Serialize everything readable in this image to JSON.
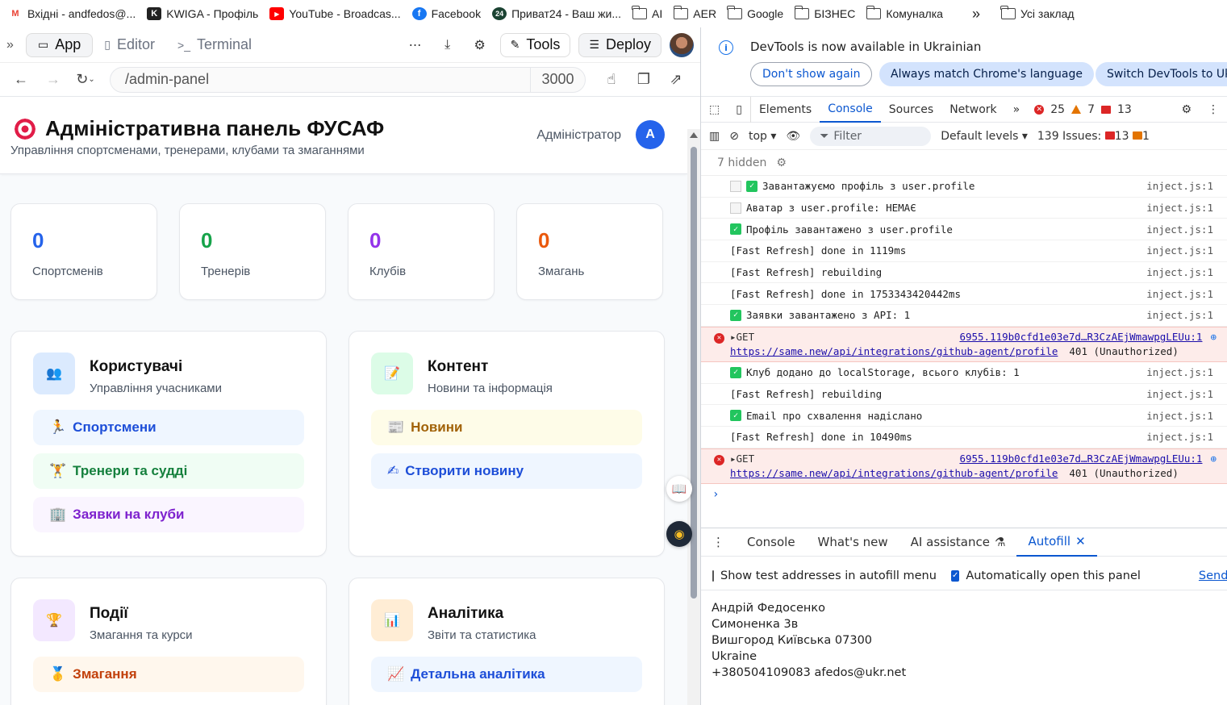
{
  "bookmarks": [
    {
      "label": "Вхідні - andfedos@...",
      "icon": "gmail-icon"
    },
    {
      "label": "KWIGA - Профіль",
      "icon": "kwiga-icon"
    },
    {
      "label": "YouTube - Broadcas...",
      "icon": "youtube-icon"
    },
    {
      "label": "Facebook",
      "icon": "facebook-icon"
    },
    {
      "label": "Приват24 - Ваш жи...",
      "icon": "privat24-icon"
    },
    {
      "label": "AI",
      "icon": "folder-icon"
    },
    {
      "label": "AER",
      "icon": "folder-icon"
    },
    {
      "label": "Google",
      "icon": "folder-icon"
    },
    {
      "label": "БІЗНЕС",
      "icon": "folder-icon"
    },
    {
      "label": "Комуналка",
      "icon": "folder-icon"
    },
    {
      "label": "Усі заклад",
      "icon": "folder-icon"
    }
  ],
  "topbar": {
    "tabs": [
      {
        "label": "App",
        "icon": "browser-icon"
      },
      {
        "label": "Editor",
        "icon": "file-icon"
      },
      {
        "label": "Terminal",
        "icon": "terminal-icon"
      }
    ],
    "tools_label": "Tools",
    "deploy_label": "Deploy"
  },
  "addressbar": {
    "url": "/admin-panel",
    "port": "3000"
  },
  "header": {
    "title": "Адміністративна панель ФУСАФ",
    "subtitle": "Управління спортсменами, тренерами, клубами та змаганнями",
    "role": "Адміністратор",
    "avatar_letter": "A"
  },
  "stats": [
    {
      "value": "0",
      "label": "Спортсменів",
      "color": "#2563eb"
    },
    {
      "value": "0",
      "label": "Тренерів",
      "color": "#16a34a"
    },
    {
      "value": "0",
      "label": "Клубів",
      "color": "#9333ea"
    },
    {
      "value": "0",
      "label": "Змагань",
      "color": "#ea580c"
    }
  ],
  "cards": {
    "users": {
      "title": "Користувачі",
      "subtitle": "Управління учасниками",
      "links": [
        "Спортсмени",
        "Тренери та судді",
        "Заявки на клуби"
      ]
    },
    "content": {
      "title": "Контент",
      "subtitle": "Новини та інформація",
      "links": [
        "Новини",
        "Створити новину"
      ]
    },
    "events": {
      "title": "Події",
      "subtitle": "Змагання та курси",
      "links": [
        "Змагання"
      ]
    },
    "analytics": {
      "title": "Аналітика",
      "subtitle": "Звіти та статистика",
      "links": [
        "Детальна аналітика"
      ]
    }
  },
  "devtools": {
    "info": "DevTools is now available in Ukrainian",
    "btn_dont_show": "Don't show again",
    "btn_match": "Always match Chrome's language",
    "btn_switch": "Switch DevTools to Uk",
    "tabs": [
      "Elements",
      "Console",
      "Sources",
      "Network"
    ],
    "errors": "25",
    "warnings": "7",
    "issues_count": "13",
    "context": "top",
    "filter": "Filter",
    "levels": "Default levels",
    "issues_label": "139 Issues:",
    "issues_red": "13",
    "issues_orange": "1",
    "hidden": "7 hidden",
    "logs": [
      {
        "text": "Завантажуємо профіль з user.profile",
        "src": "inject.js:1",
        "icons": "memo-check"
      },
      {
        "text": "Аватар з user.profile: НЕМАЄ",
        "src": "inject.js:1",
        "icons": "memo"
      },
      {
        "text": "Профіль завантажено з user.profile",
        "src": "inject.js:1",
        "icons": "check"
      },
      {
        "text": "[Fast Refresh] done in 1119ms",
        "src": "inject.js:1",
        "icons": ""
      },
      {
        "text": "[Fast Refresh] rebuilding",
        "src": "inject.js:1",
        "icons": ""
      },
      {
        "text": "[Fast Refresh] done in 1753343420442ms",
        "src": "inject.js:1",
        "icons": ""
      },
      {
        "text": "Заявки завантажено з API: 1",
        "src": "inject.js:1",
        "icons": "check"
      }
    ],
    "error1": {
      "method": "GET",
      "src": "6955.119b0cfd1e03e7d…R3CzAEjWmawpgLEUu:1",
      "url": "https://same.new/api/integrations/github-agent/profile",
      "status": "401 (Unauthorized)"
    },
    "logs2": [
      {
        "text": "Клуб додано до localStorage, всього клубів: 1",
        "src": "inject.js:1",
        "icons": "check"
      },
      {
        "text": "[Fast Refresh] rebuilding",
        "src": "inject.js:1",
        "icons": ""
      },
      {
        "text": "Email про схвалення надіслано",
        "src": "inject.js:1",
        "icons": "check"
      },
      {
        "text": "[Fast Refresh] done in 10490ms",
        "src": "inject.js:1",
        "icons": ""
      }
    ],
    "error2": {
      "method": "GET",
      "src": "6955.119b0cfd1e03e7d…R3CzAEjWmawpgLEUu:1",
      "url": "https://same.new/api/integrations/github-agent/profile",
      "status": "401 (Unauthorized)"
    },
    "drawer_tabs": [
      "Console",
      "What's new",
      "AI assistance",
      "Autofill"
    ],
    "autofill": {
      "opt1": "Show test addresses in autofill menu",
      "opt2": "Automatically open this panel",
      "send_feedback": "Send feed",
      "address": [
        "Андрій Федосенко",
        "Симоненка 3в",
        "Вишгород Київська 07300",
        "Ukraine",
        "+380504109083 afedos@ukr.net"
      ]
    }
  }
}
